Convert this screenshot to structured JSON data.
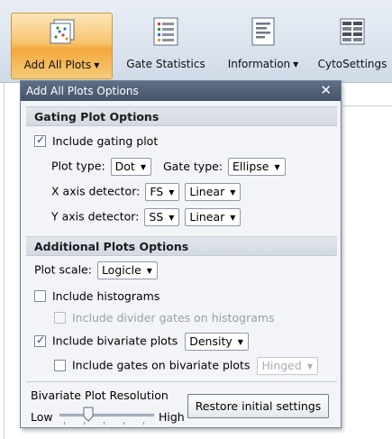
{
  "ribbon": {
    "buttons": [
      {
        "label": "Add All Plots",
        "has_dropdown": true,
        "icon": "scatter-plot-icon"
      },
      {
        "label": "Gate Statistics",
        "has_dropdown": false,
        "icon": "statistics-table-icon"
      },
      {
        "label": "Information",
        "has_dropdown": true,
        "icon": "information-list-icon"
      },
      {
        "label": "CytoSettings",
        "has_dropdown": false,
        "icon": "settings-grid-icon"
      }
    ]
  },
  "popup": {
    "title": "Add All Plots Options",
    "close_glyph": "✕",
    "gating": {
      "header": "Gating Plot Options",
      "include_label": "Include gating plot",
      "include_checked": true,
      "plot_type_label": "Plot type:",
      "plot_type_value": "Dot",
      "gate_type_label": "Gate type:",
      "gate_type_value": "Ellipse",
      "x_label": "X axis detector:",
      "x_detector": "FS",
      "x_scale": "Linear",
      "y_label": "Y axis detector:",
      "y_detector": "SS",
      "y_scale": "Linear"
    },
    "additional": {
      "header": "Additional Plots Options",
      "plot_scale_label": "Plot scale:",
      "plot_scale_value": "Logicle",
      "histograms_label": "Include histograms",
      "histograms_checked": false,
      "divider_gates_label": "Include divider gates on histograms",
      "divider_gates_checked": false,
      "bivariate_label": "Include bivariate plots",
      "bivariate_checked": true,
      "bivariate_type": "Density",
      "gates_bivariate_label": "Include gates on bivariate plots",
      "gates_bivariate_checked": false,
      "gates_bivariate_type": "Hinged"
    },
    "resolution": {
      "label": "Bivariate Plot Resolution",
      "low": "Low",
      "high": "High",
      "value_fraction": 0.3
    },
    "restore_label": "Restore initial settings"
  },
  "colors": {
    "title_bar": "#4f5e75",
    "active_button": "#f6b04f",
    "ribbon": "#dbe3ee"
  }
}
